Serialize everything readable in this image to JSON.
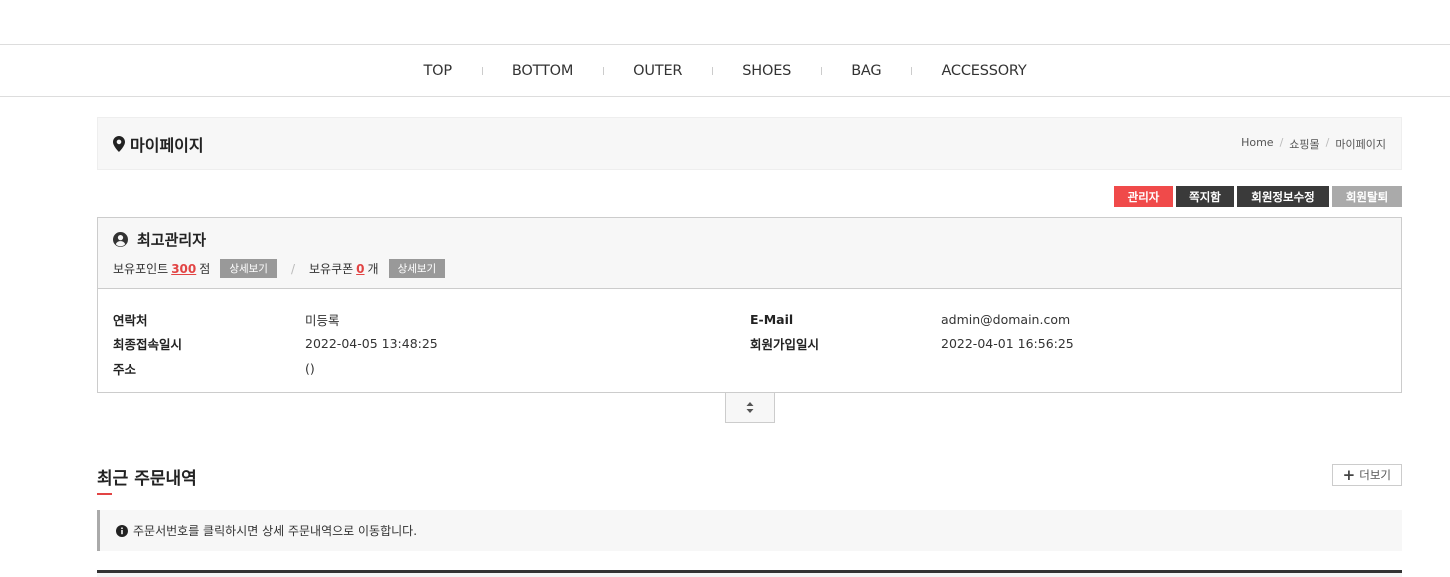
{
  "gnb": {
    "items": [
      "TOP",
      "BOTTOM",
      "OUTER",
      "SHOES",
      "BAG",
      "ACCESSORY"
    ]
  },
  "page_head": {
    "title": "마이페이지",
    "icon": "map-marker-icon",
    "breadcrumb": [
      "Home",
      "쇼핑몰",
      "마이페이지"
    ]
  },
  "actions": {
    "admin": "관리자",
    "messages": "쪽지함",
    "edit_profile": "회원정보수정",
    "withdraw": "회원탈퇴"
  },
  "member": {
    "name": "최고관리자",
    "points_label": "보유포인트",
    "points_value": "300",
    "points_unit": "점",
    "points_detail": "상세보기",
    "coupon_label": "보유쿠폰",
    "coupon_value": "0",
    "coupon_unit": "개",
    "coupon_detail": "상세보기",
    "info": {
      "contact_label": "연락처",
      "contact_value": "미등록",
      "email_label": "E-Mail",
      "email_value": "admin@domain.com",
      "last_login_label": "최종접속일시",
      "last_login_value": "2022-04-05 13:48:25",
      "join_label": "회원가입일시",
      "join_value": "2022-04-01 16:56:25",
      "address_label": "주소",
      "address_value": "()"
    }
  },
  "orders": {
    "title": "최근 주문내역",
    "more_label": "더보기",
    "notice": "주문서번호를 클릭하시면 상세 주문내역으로 이동합니다."
  },
  "colors": {
    "accent_red": "#f04a4a",
    "dark": "#3a3a3a",
    "gray": "#aaaaaa"
  }
}
